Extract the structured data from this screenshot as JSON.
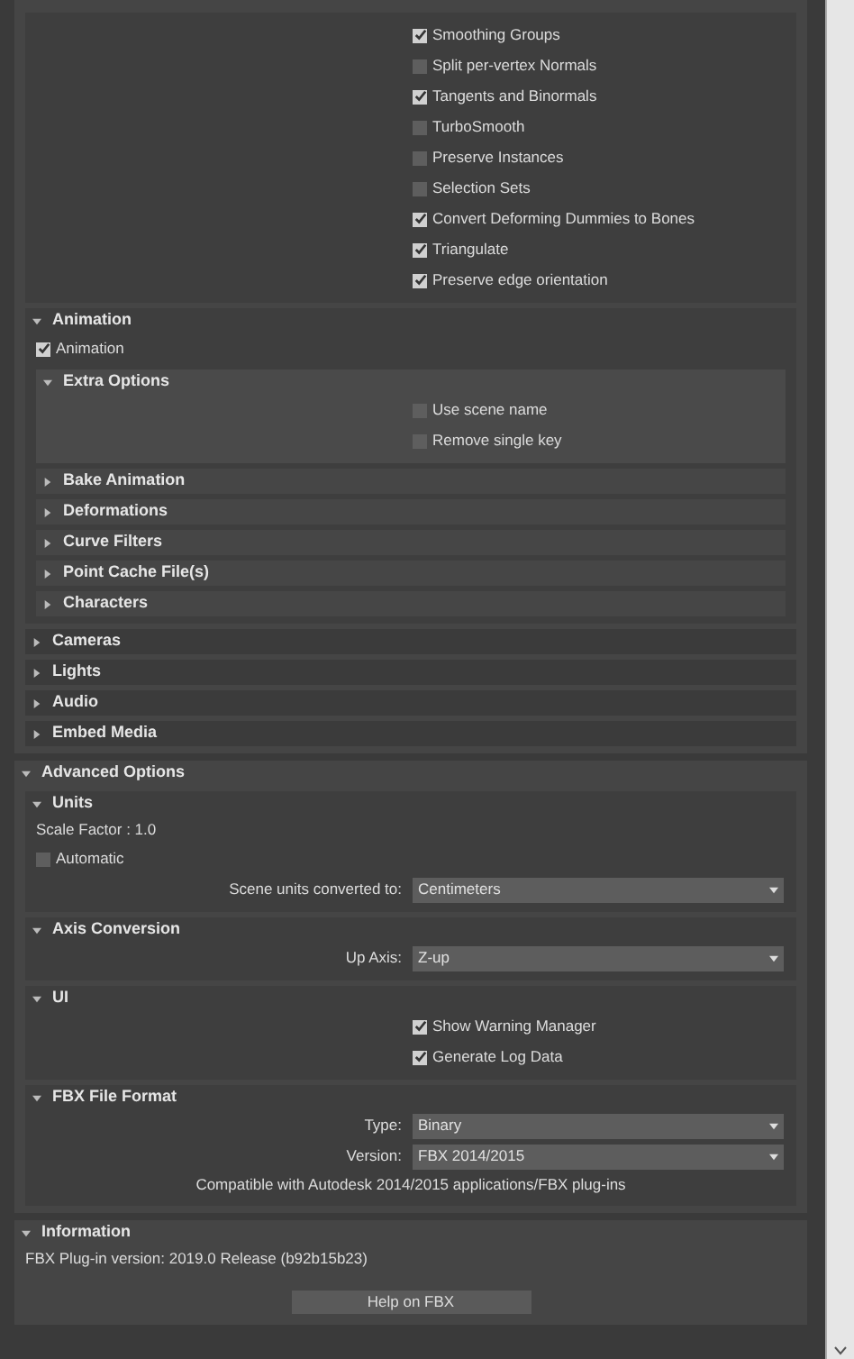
{
  "sections": [
    {
      "expanded": true,
      "items": [
        {
          "kind": "section",
          "expanded": true,
          "items": [
            {
              "kind": "option",
              "label": "Smoothing Groups",
              "checked": true
            },
            {
              "kind": "option",
              "label": "Split per-vertex Normals",
              "checked": false
            },
            {
              "kind": "option",
              "label": "Tangents and Binormals",
              "checked": true
            },
            {
              "kind": "option",
              "label": "TurboSmooth",
              "checked": false
            },
            {
              "kind": "option",
              "label": "Preserve Instances",
              "checked": false
            },
            {
              "kind": "option",
              "label": "Selection Sets",
              "checked": false
            },
            {
              "kind": "option",
              "label": "Convert Deforming Dummies to Bones",
              "checked": true
            },
            {
              "kind": "option",
              "label": "Triangulate",
              "checked": true
            },
            {
              "kind": "option",
              "label": "Preserve edge orientation",
              "checked": true
            }
          ]
        },
        {
          "kind": "section",
          "title": "Animation",
          "expanded": true,
          "items": [
            {
              "kind": "checkbox",
              "label": "Animation",
              "checked": true
            },
            {
              "kind": "section",
              "title": "Extra Options",
              "expanded": true,
              "items": [
                {
                  "kind": "option",
                  "label": "Use scene name",
                  "checked": false
                },
                {
                  "kind": "option",
                  "label": "Remove single key",
                  "checked": false
                }
              ]
            },
            {
              "kind": "section",
              "title": "Bake Animation",
              "expanded": false
            },
            {
              "kind": "section",
              "title": "Deformations",
              "expanded": false
            },
            {
              "kind": "section",
              "title": "Curve Filters",
              "expanded": false
            },
            {
              "kind": "section",
              "title": "Point Cache File(s)",
              "expanded": false
            },
            {
              "kind": "section",
              "title": "Characters",
              "expanded": false
            }
          ]
        },
        {
          "kind": "section",
          "title": "Cameras",
          "expanded": false
        },
        {
          "kind": "section",
          "title": "Lights",
          "expanded": false
        },
        {
          "kind": "section",
          "title": "Audio",
          "expanded": false
        },
        {
          "kind": "section",
          "title": "Embed Media",
          "expanded": false
        }
      ]
    },
    {
      "title": "Advanced Options",
      "expanded": true,
      "items": [
        {
          "kind": "section",
          "title": "Units",
          "expanded": true,
          "items": [
            {
              "kind": "text",
              "text": "Scale Factor : 1.0"
            },
            {
              "kind": "checkbox",
              "label": "Automatic",
              "checked": false
            },
            {
              "kind": "dropdown",
              "label": "Scene units converted to:",
              "value": "Centimeters"
            }
          ]
        },
        {
          "kind": "section",
          "title": "Axis Conversion",
          "expanded": true,
          "items": [
            {
              "kind": "dropdown",
              "label": "Up Axis:",
              "value": "Z-up"
            }
          ]
        },
        {
          "kind": "section",
          "title": "UI",
          "expanded": true,
          "items": [
            {
              "kind": "option",
              "label": "Show Warning Manager",
              "checked": true
            },
            {
              "kind": "option",
              "label": "Generate Log Data",
              "checked": true
            }
          ]
        },
        {
          "kind": "section",
          "title": "FBX File Format",
          "expanded": true,
          "items": [
            {
              "kind": "dropdown",
              "label": "Type:",
              "value": "Binary"
            },
            {
              "kind": "dropdown",
              "label": "Version:",
              "value": "FBX 2014/2015"
            },
            {
              "kind": "note",
              "text": "Compatible with Autodesk 2014/2015 applications/FBX plug-ins"
            }
          ]
        }
      ]
    },
    {
      "title": "Information",
      "expanded": true,
      "items": [
        {
          "kind": "text",
          "text": "FBX Plug-in version: 2019.0 Release (b92b15b23)"
        },
        {
          "kind": "button",
          "label": "Help on FBX"
        }
      ]
    }
  ]
}
